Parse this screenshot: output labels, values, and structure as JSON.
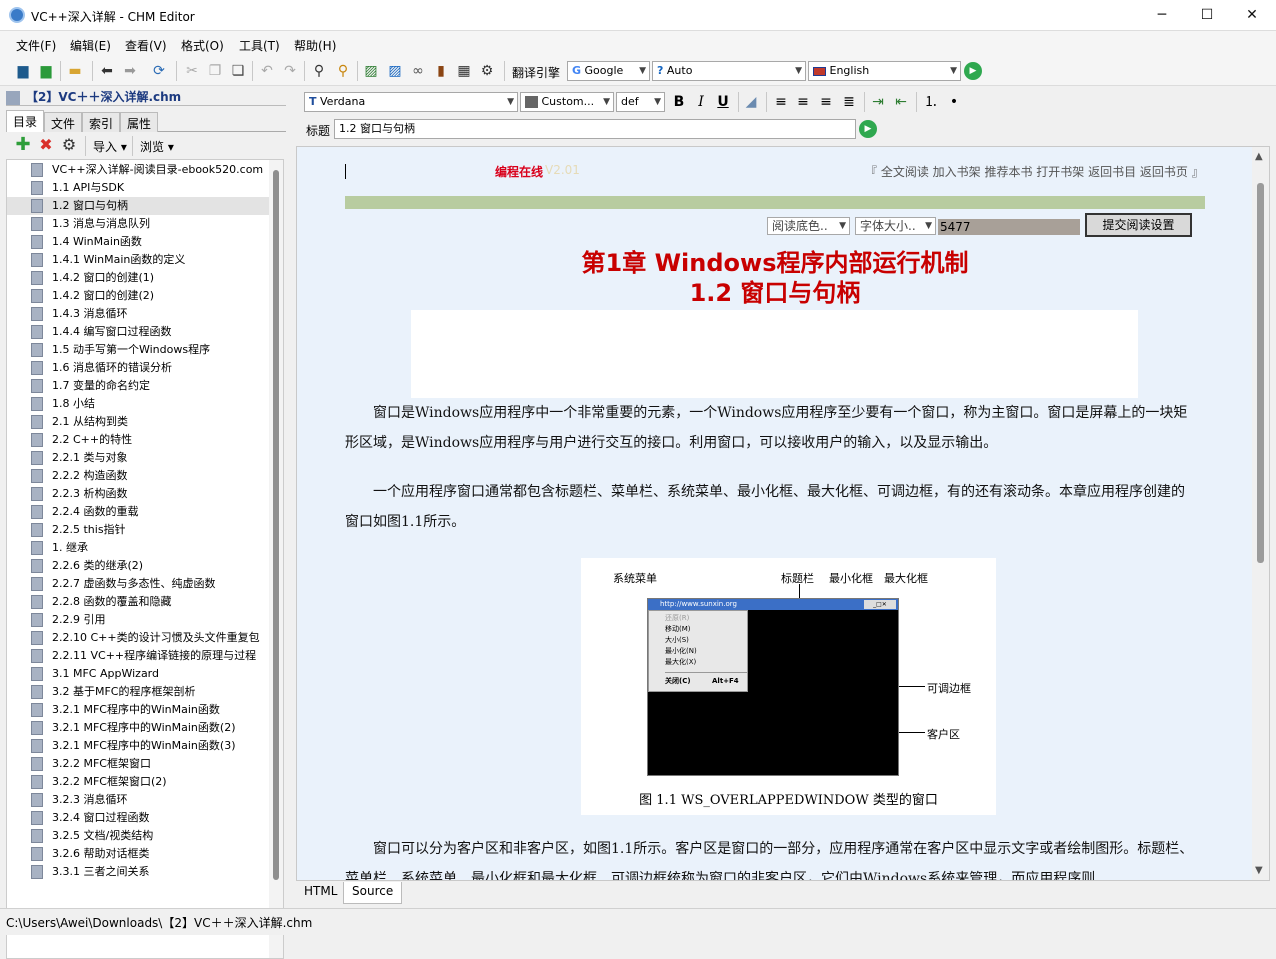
{
  "window": {
    "title": "VC++深入详解 - CHM Editor",
    "controls": {
      "minimize": "─",
      "maximize": "☐",
      "close": "✕"
    }
  },
  "menu": [
    "文件(F)",
    "编辑(E)",
    "查看(V)",
    "格式(O)",
    "工具(T)",
    "帮助(H)"
  ],
  "toolbar": {
    "translate_label": "翻译引擎",
    "engine": "Google",
    "source_lang": "Auto",
    "target_lang": "English"
  },
  "left": {
    "file_title": "【2】VC＋＋深入详解.chm",
    "tabs": [
      "目录",
      "文件",
      "索引",
      "属性"
    ],
    "import_label": "导入",
    "browse_label": "浏览",
    "tree_items": [
      "VC++深入详解-阅读目录-ebook520.com",
      "1.1 API与SDK",
      "1.2 窗口与句柄",
      "1.3 消息与消息队列",
      "1.4 WinMain函数",
      "1.4.1 WinMain函数的定义",
      "1.4.2 窗口的创建(1)",
      "1.4.2 窗口的创建(2)",
      "1.4.3 消息循环",
      "1.4.4 编写窗口过程函数",
      "1.5 动手写第一个Windows程序",
      "1.6 消息循环的错误分析",
      "1.7 变量的命名约定",
      "1.8 小结",
      "2.1 从结构到类",
      "2.2 C++的特性",
      "2.2.1 类与对象",
      "2.2.2 构造函数",
      "2.2.3 析构函数",
      "2.2.4 函数的重载",
      "2.2.5 this指针",
      "1. 继承",
      "2.2.6 类的继承(2)",
      "2.2.7 虚函数与多态性、纯虚函数",
      "2.2.8 函数的覆盖和隐藏",
      "2.2.9 引用",
      "2.2.10 C++类的设计习惯及头文件重复包",
      "2.2.11 VC++程序编译链接的原理与过程",
      "3.1 MFC AppWizard",
      "3.2 基于MFC的程序框架剖析",
      "3.2.1 MFC程序中的WinMain函数",
      "3.2.1 MFC程序中的WinMain函数(2)",
      "3.2.1 MFC程序中的WinMain函数(3)",
      "3.2.2 MFC框架窗口",
      "3.2.2 MFC框架窗口(2)",
      "3.2.3 消息循环",
      "3.2.4 窗口过程函数",
      "3.2.5 文档/视类结构",
      "3.2.6 帮助对话框类",
      "3.3.1 三者之间关系"
    ]
  },
  "format": {
    "font": "Verdana",
    "color": "Custom...",
    "size": "def",
    "title_label": "标题",
    "title_value": "1.2 窗口与句柄"
  },
  "page": {
    "site_name": "编程在线",
    "site_version": "V2.01",
    "nav_links": "『 全文阅读 加入书架 推荐本书 打开书架 返回书目 返回书页 』",
    "bg_select": "阅读底色..",
    "font_select": "字体大小..",
    "number_field": "5477",
    "submit_button": "提交阅读设置",
    "chapter_title": "第1章 Windows程序内部运行机制",
    "section_title": "1.2 窗口与句柄",
    "para1": "窗口是Windows应用程序中一个非常重要的元素，一个Windows应用程序至少要有一个窗口，称为主窗口。窗口是屏幕上的一块矩形区域，是Windows应用程序与用户进行交互的接口。利用窗口，可以接收用户的输入，以及显示输出。",
    "para2": "一个应用程序窗口通常都包含标题栏、菜单栏、系统菜单、最小化框、最大化框、可调边框，有的还有滚动条。本章应用程序创建的窗口如图1.1所示。",
    "para3": "窗口可以分为客户区和非客户区，如图1.1所示。客户区是窗口的一部分，应用程序通常在客户区中显示文字或者绘制图形。标题栏、菜单栏、系统菜单、最小化框和最大化框、可调边框统称为窗口的非客户区，它们由Windows系统来管理，而应用程序则",
    "figure": {
      "label_sysmenu": "系统菜单",
      "label_titlebar": "标题栏",
      "label_min": "最小化框",
      "label_max": "最大化框",
      "label_border": "可调边框",
      "label_client": "客户区",
      "url": "http://www.sunxin.org",
      "menu_items": [
        "还原(R)",
        "移动(M)",
        "大小(S)",
        "最小化(N)",
        "最大化(X)"
      ],
      "menu_close": "关闭(C)",
      "menu_close_key": "Alt+F4",
      "caption": "图 1.1   WS_OVERLAPPEDWINDOW 类型的窗口"
    }
  },
  "bottom_tabs": [
    "HTML",
    "Source"
  ],
  "status": "C:\\Users\\Awei\\Downloads\\【2】VC＋＋深入详解.chm"
}
